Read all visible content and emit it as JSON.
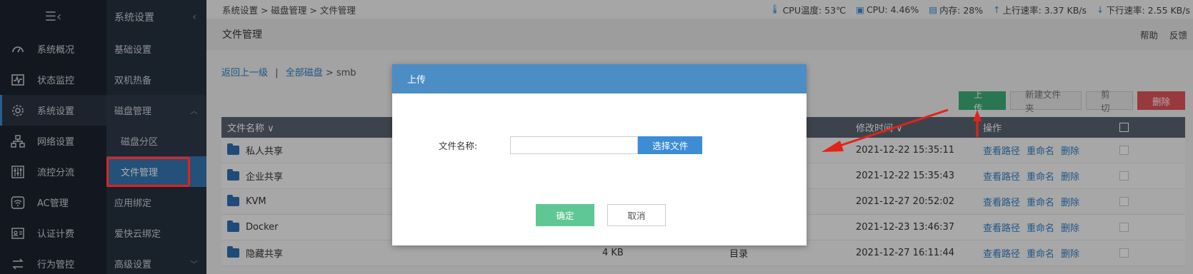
{
  "nav_main": {
    "items": [
      {
        "label": "系统概况",
        "icon": "dashboard-icon"
      },
      {
        "label": "状态监控",
        "icon": "pulse-icon"
      },
      {
        "label": "系统设置",
        "icon": "gear-icon",
        "active": true
      },
      {
        "label": "网络设置",
        "icon": "network-icon"
      },
      {
        "label": "流控分流",
        "icon": "sliders-icon"
      },
      {
        "label": "AC管理",
        "icon": "wifi-icon"
      },
      {
        "label": "认证计费",
        "icon": "id-card-icon"
      },
      {
        "label": "行为管控",
        "icon": "swap-icon"
      }
    ]
  },
  "nav_sub": {
    "title": "系统设置",
    "items": [
      "基础设置",
      "双机热备",
      "磁盘管理",
      "磁盘分区",
      "文件管理",
      "应用绑定",
      "爱快云绑定",
      "高级设置"
    ]
  },
  "topbar": {
    "breadcrumb": "系统设置 > 磁盘管理 > 文件管理",
    "cpu_temp": "CPU温度: 53℃",
    "cpu": "CPU: 4.46%",
    "mem": "内存: 28%",
    "up": "上行速率: 3.37 KB/s",
    "down": "下行速率: 2.55 KB/s"
  },
  "page": {
    "title": "文件管理",
    "help": "帮助",
    "feedback": "反馈",
    "back": "返回上一级",
    "sep": "|",
    "all_disks": "全部磁盘",
    "path": "> smb"
  },
  "actions": {
    "upload": "上传",
    "new_folder": "新建文件夹",
    "cut": "剪切",
    "delete": "删除"
  },
  "table": {
    "headers": {
      "name": "文件名称 ∨",
      "time": "修改时间 ∨",
      "ops": "操作"
    },
    "ops": {
      "view": "查看路径",
      "rename": "重命名",
      "delete": "删除"
    },
    "rows": [
      {
        "name": "私人共享",
        "size": "",
        "type": "",
        "time": "2021-12-22 15:35:11"
      },
      {
        "name": "企业共享",
        "size": "",
        "type": "",
        "time": "2021-12-22 15:35:43"
      },
      {
        "name": "KVM",
        "size": "",
        "type": "",
        "time": "2021-12-27 20:52:02"
      },
      {
        "name": "Docker",
        "size": "",
        "type": "",
        "time": "2021-12-23 13:46:37"
      },
      {
        "name": "隐藏共享",
        "size": "4 KB",
        "type": "目录",
        "time": "2021-12-27 16:11:44"
      }
    ]
  },
  "modal": {
    "title": "上传",
    "field_label": "文件名称:",
    "choose": "选择文件",
    "ok": "确定",
    "cancel": "取消"
  },
  "colors": {
    "accent": "#4c8dc5",
    "green": "#3ead7a",
    "red": "#e0545b",
    "annotation": "#e2231a"
  }
}
